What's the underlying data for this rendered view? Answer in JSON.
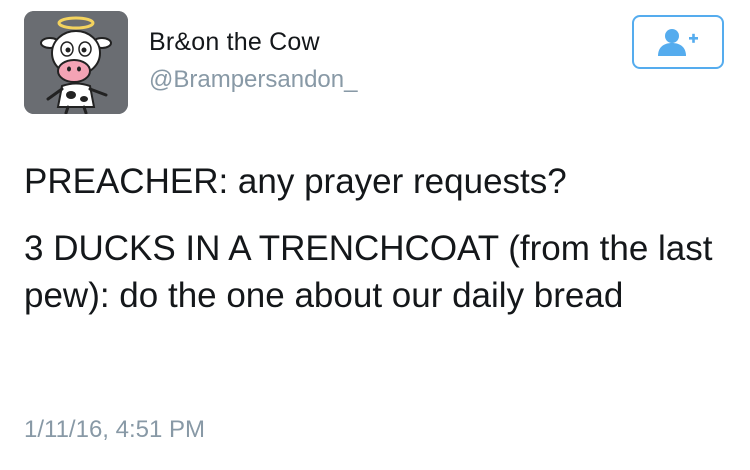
{
  "account": {
    "display_name": "Br&on the Cow",
    "handle": "@Brampersandon_",
    "avatar_icon": "cartoon-cow-with-halo"
  },
  "follow_button": {
    "icon": "add-user-icon"
  },
  "tweet": {
    "line1": "PREACHER: any prayer requests?",
    "line2": "3 DUCKS IN A TRENCHCOAT (from the last pew): do the one about our daily bread",
    "timestamp": "1/11/16, 4:51 PM"
  },
  "colors": {
    "accent": "#55acee",
    "text": "#14171a",
    "muted": "#8899a6"
  }
}
